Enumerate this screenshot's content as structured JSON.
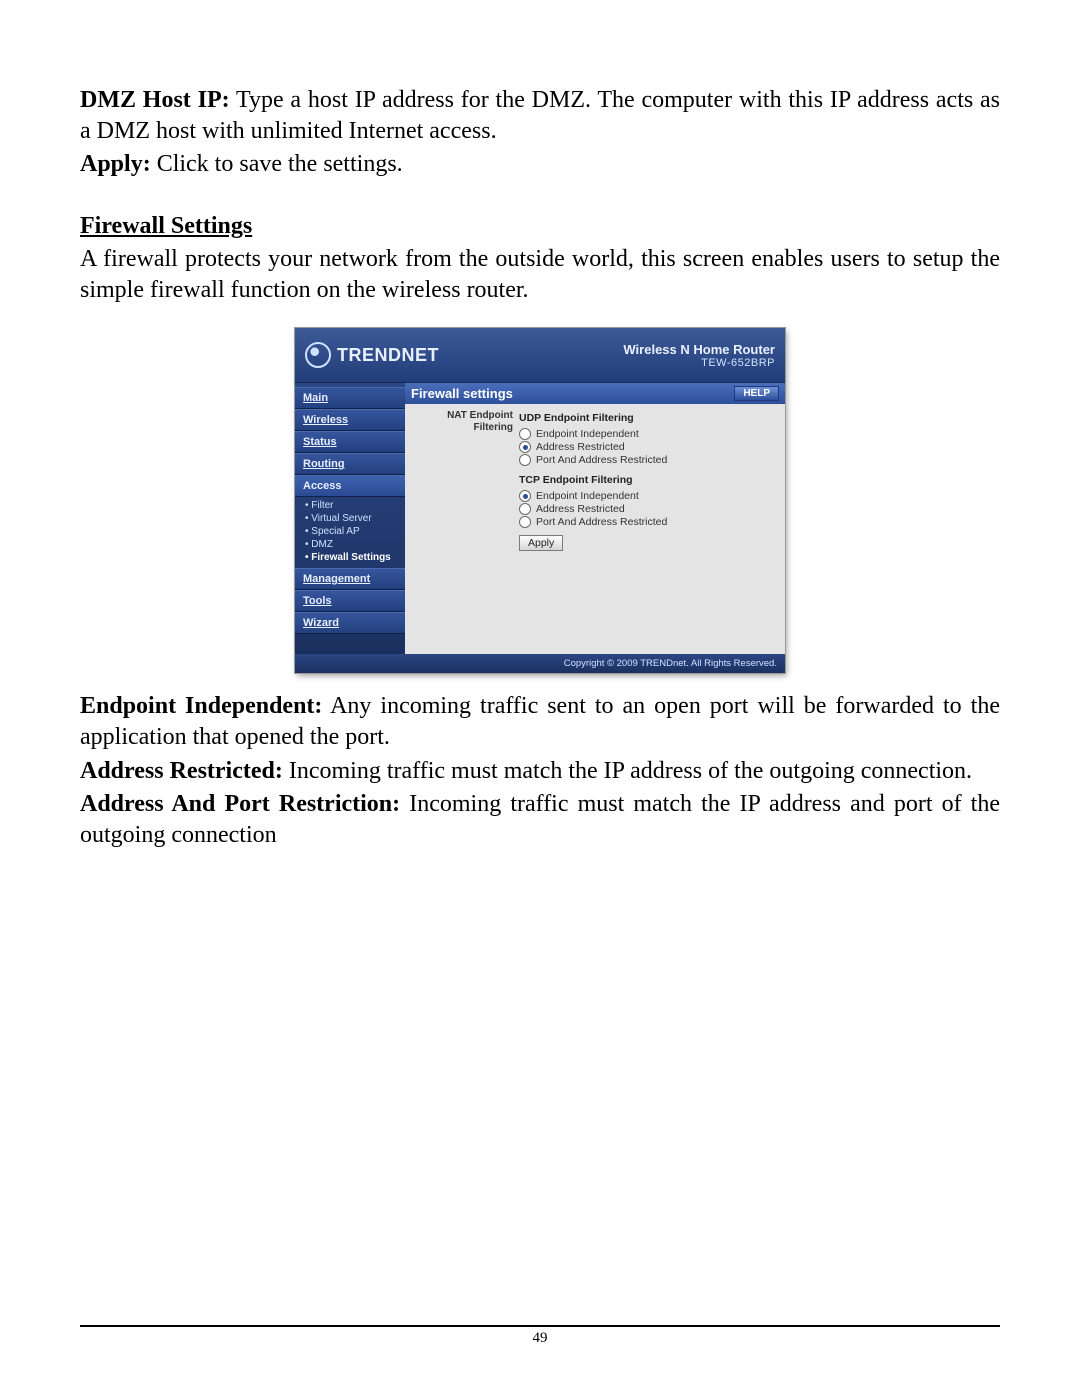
{
  "doc": {
    "para1": {
      "label": "DMZ Host IP:",
      "text": " Type a host IP address for the DMZ. The computer with this IP address acts as a DMZ host with unlimited Internet access."
    },
    "para2": {
      "label": "Apply:",
      "text": " Click to save the settings."
    },
    "section_title": "Firewall Settings",
    "para3": "A firewall protects your network from the outside world, this screen enables users to setup the simple firewall function on the wireless router.",
    "para4": {
      "label": "Endpoint Independent:",
      "text": " Any incoming traffic sent to an open port will be forwarded to the application that opened the port."
    },
    "para5": {
      "label": "Address Restricted:",
      "text": " Incoming traffic must match the IP address of the outgoing connection."
    },
    "para6": {
      "label": "Address And Port Restriction:",
      "text": " Incoming traffic must match the IP address and port of the outgoing connection"
    },
    "page_number": "49"
  },
  "router": {
    "brand": "TRENDNET",
    "top_title": "Wireless N Home Router",
    "model": "TEW-652BRP",
    "nav": {
      "main": "Main",
      "wireless": "Wireless",
      "status": "Status",
      "routing": "Routing",
      "access": "Access",
      "management": "Management",
      "tools": "Tools",
      "wizard": "Wizard"
    },
    "subnav": {
      "filter": "Filter",
      "virtual_server": "Virtual Server",
      "special_ap": "Special AP",
      "dmz": "DMZ",
      "firewall": "Firewall Settings"
    },
    "content": {
      "title": "Firewall settings",
      "help": "HELP",
      "row_label": "NAT Endpoint Filtering",
      "udp_title": "UDP Endpoint Filtering",
      "tcp_title": "TCP Endpoint Filtering",
      "opt_endpoint": "Endpoint Independent",
      "opt_address": "Address Restricted",
      "opt_port": "Port And Address Restricted",
      "apply": "Apply"
    },
    "footer": "Copyright © 2009 TRENDnet. All Rights Reserved."
  }
}
